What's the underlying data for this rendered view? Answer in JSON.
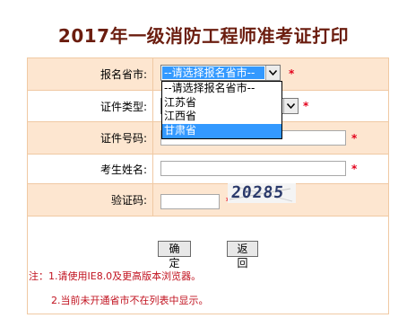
{
  "title": "2017年一级消防工程师准考证打印",
  "form": {
    "province": {
      "label": "报名省市:",
      "selected": "--请选择报名省市--",
      "required": "*",
      "options": [
        "--请选择报名省市--",
        "江苏省",
        "江西省",
        "甘肃省"
      ],
      "highlighted_option": "甘肃省"
    },
    "cert_type": {
      "label": "证件类型:",
      "required": "*"
    },
    "cert_number": {
      "label": "证件号码:",
      "value": "",
      "required": "*"
    },
    "name": {
      "label": "考生姓名:",
      "value": "",
      "required": "*"
    },
    "captcha": {
      "label": "验证码:",
      "value": "",
      "required": "*",
      "image_text": "20285"
    }
  },
  "buttons": {
    "confirm": "确 定",
    "back": "返 回"
  },
  "notes": {
    "line1": "注：1.请使用IE8.0及更高版本浏览器。",
    "line2": "2.当前未开通省市不在列表中显示。"
  },
  "colors": {
    "title": "#6b1d0f",
    "row_shade": "#fde6d0",
    "border": "#f0c9a3",
    "required": "#e3001b",
    "selection": "#3399ff",
    "note": "#c1121f"
  }
}
